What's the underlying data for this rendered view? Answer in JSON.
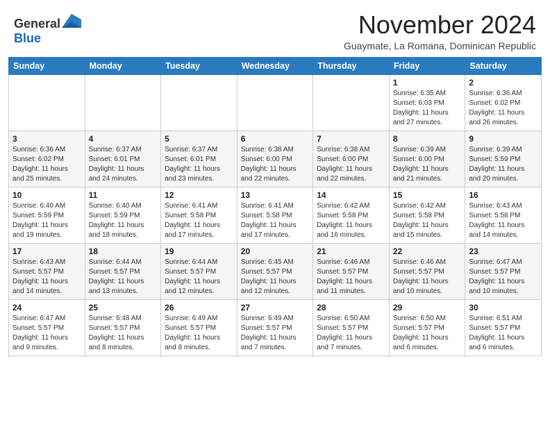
{
  "header": {
    "logo_general": "General",
    "logo_blue": "Blue",
    "month_title": "November 2024",
    "subtitle": "Guaymate, La Romana, Dominican Republic"
  },
  "weekdays": [
    "Sunday",
    "Monday",
    "Tuesday",
    "Wednesday",
    "Thursday",
    "Friday",
    "Saturday"
  ],
  "weeks": [
    [
      {
        "day": "",
        "info": ""
      },
      {
        "day": "",
        "info": ""
      },
      {
        "day": "",
        "info": ""
      },
      {
        "day": "",
        "info": ""
      },
      {
        "day": "",
        "info": ""
      },
      {
        "day": "1",
        "info": "Sunrise: 6:35 AM\nSunset: 6:03 PM\nDaylight: 11 hours\nand 27 minutes."
      },
      {
        "day": "2",
        "info": "Sunrise: 6:36 AM\nSunset: 6:02 PM\nDaylight: 11 hours\nand 26 minutes."
      }
    ],
    [
      {
        "day": "3",
        "info": "Sunrise: 6:36 AM\nSunset: 6:02 PM\nDaylight: 11 hours\nand 25 minutes."
      },
      {
        "day": "4",
        "info": "Sunrise: 6:37 AM\nSunset: 6:01 PM\nDaylight: 11 hours\nand 24 minutes."
      },
      {
        "day": "5",
        "info": "Sunrise: 6:37 AM\nSunset: 6:01 PM\nDaylight: 11 hours\nand 23 minutes."
      },
      {
        "day": "6",
        "info": "Sunrise: 6:38 AM\nSunset: 6:00 PM\nDaylight: 11 hours\nand 22 minutes."
      },
      {
        "day": "7",
        "info": "Sunrise: 6:38 AM\nSunset: 6:00 PM\nDaylight: 11 hours\nand 22 minutes."
      },
      {
        "day": "8",
        "info": "Sunrise: 6:39 AM\nSunset: 6:00 PM\nDaylight: 11 hours\nand 21 minutes."
      },
      {
        "day": "9",
        "info": "Sunrise: 6:39 AM\nSunset: 5:59 PM\nDaylight: 11 hours\nand 20 minutes."
      }
    ],
    [
      {
        "day": "10",
        "info": "Sunrise: 6:40 AM\nSunset: 5:59 PM\nDaylight: 11 hours\nand 19 minutes."
      },
      {
        "day": "11",
        "info": "Sunrise: 6:40 AM\nSunset: 5:59 PM\nDaylight: 11 hours\nand 18 minutes."
      },
      {
        "day": "12",
        "info": "Sunrise: 6:41 AM\nSunset: 5:58 PM\nDaylight: 11 hours\nand 17 minutes."
      },
      {
        "day": "13",
        "info": "Sunrise: 6:41 AM\nSunset: 5:58 PM\nDaylight: 11 hours\nand 17 minutes."
      },
      {
        "day": "14",
        "info": "Sunrise: 6:42 AM\nSunset: 5:58 PM\nDaylight: 11 hours\nand 16 minutes."
      },
      {
        "day": "15",
        "info": "Sunrise: 6:42 AM\nSunset: 5:58 PM\nDaylight: 11 hours\nand 15 minutes."
      },
      {
        "day": "16",
        "info": "Sunrise: 6:43 AM\nSunset: 5:58 PM\nDaylight: 11 hours\nand 14 minutes."
      }
    ],
    [
      {
        "day": "17",
        "info": "Sunrise: 6:43 AM\nSunset: 5:57 PM\nDaylight: 11 hours\nand 14 minutes."
      },
      {
        "day": "18",
        "info": "Sunrise: 6:44 AM\nSunset: 5:57 PM\nDaylight: 11 hours\nand 13 minutes."
      },
      {
        "day": "19",
        "info": "Sunrise: 6:44 AM\nSunset: 5:57 PM\nDaylight: 11 hours\nand 12 minutes."
      },
      {
        "day": "20",
        "info": "Sunrise: 6:45 AM\nSunset: 5:57 PM\nDaylight: 11 hours\nand 12 minutes."
      },
      {
        "day": "21",
        "info": "Sunrise: 6:46 AM\nSunset: 5:57 PM\nDaylight: 11 hours\nand 11 minutes."
      },
      {
        "day": "22",
        "info": "Sunrise: 6:46 AM\nSunset: 5:57 PM\nDaylight: 11 hours\nand 10 minutes."
      },
      {
        "day": "23",
        "info": "Sunrise: 6:47 AM\nSunset: 5:57 PM\nDaylight: 11 hours\nand 10 minutes."
      }
    ],
    [
      {
        "day": "24",
        "info": "Sunrise: 6:47 AM\nSunset: 5:57 PM\nDaylight: 11 hours\nand 9 minutes."
      },
      {
        "day": "25",
        "info": "Sunrise: 6:48 AM\nSunset: 5:57 PM\nDaylight: 11 hours\nand 8 minutes."
      },
      {
        "day": "26",
        "info": "Sunrise: 6:49 AM\nSunset: 5:57 PM\nDaylight: 11 hours\nand 8 minutes."
      },
      {
        "day": "27",
        "info": "Sunrise: 6:49 AM\nSunset: 5:57 PM\nDaylight: 11 hours\nand 7 minutes."
      },
      {
        "day": "28",
        "info": "Sunrise: 6:50 AM\nSunset: 5:57 PM\nDaylight: 11 hours\nand 7 minutes."
      },
      {
        "day": "29",
        "info": "Sunrise: 6:50 AM\nSunset: 5:57 PM\nDaylight: 11 hours\nand 6 minutes."
      },
      {
        "day": "30",
        "info": "Sunrise: 6:51 AM\nSunset: 5:57 PM\nDaylight: 11 hours\nand 6 minutes."
      }
    ]
  ]
}
